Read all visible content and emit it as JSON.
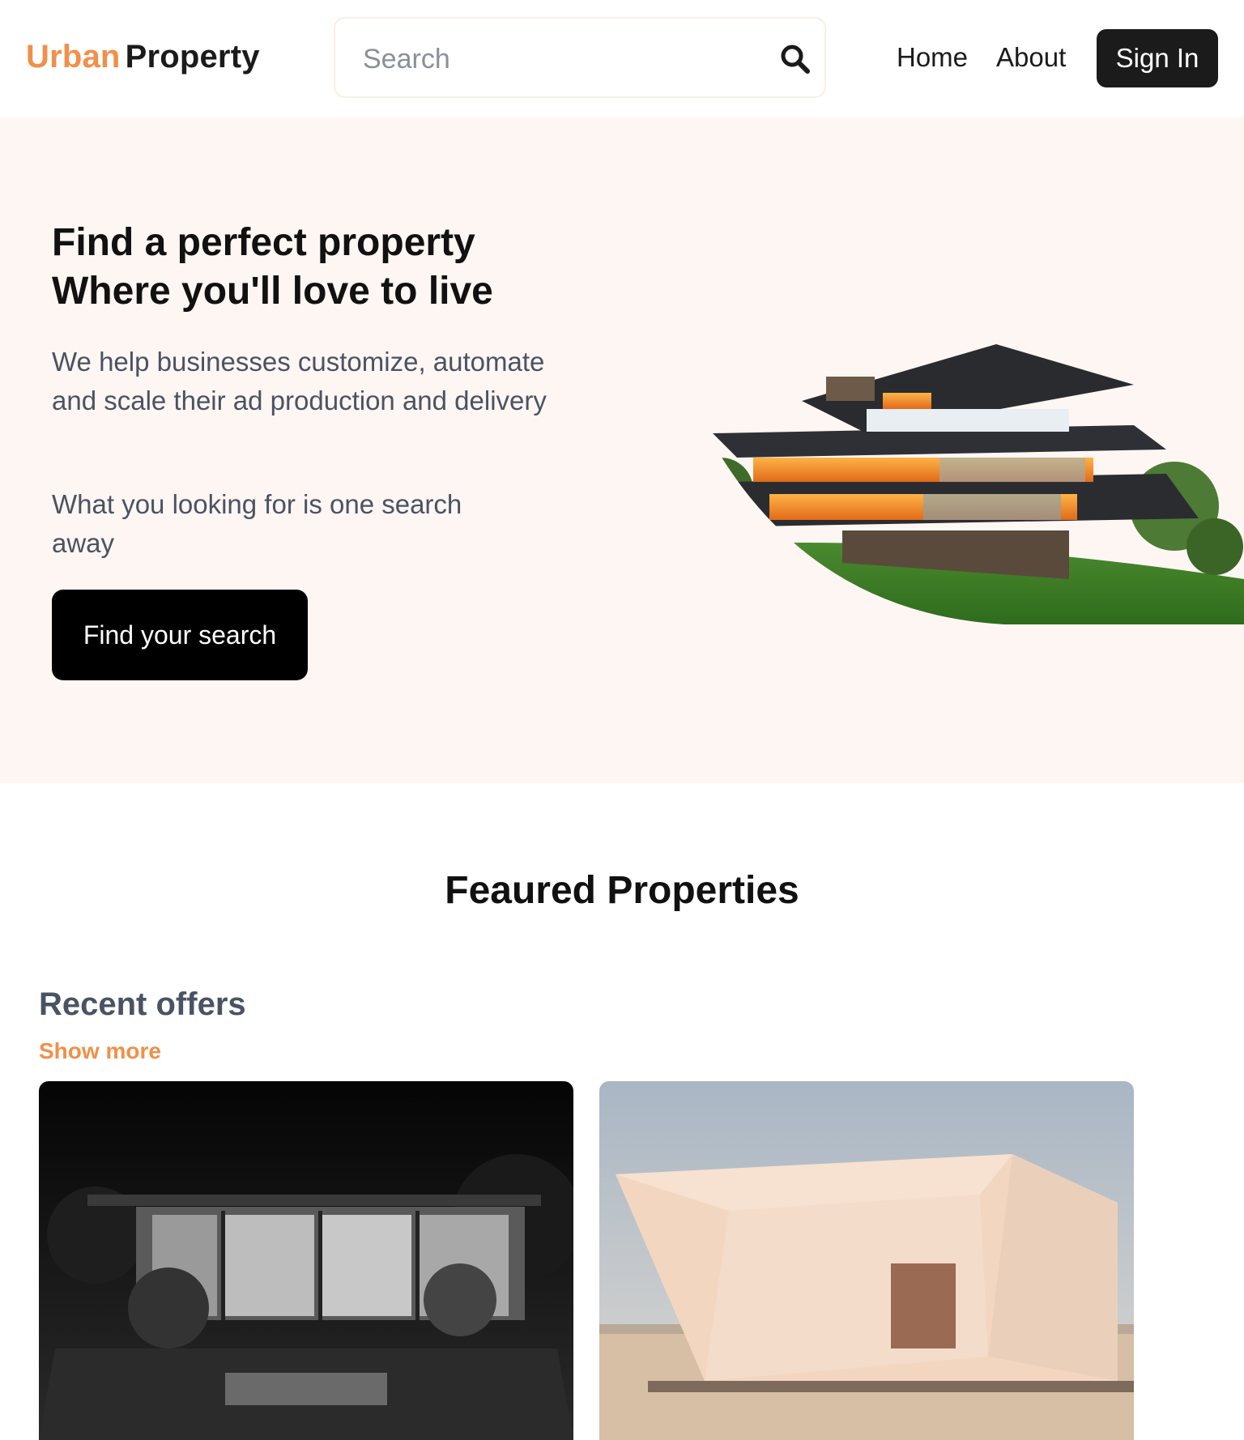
{
  "header": {
    "logo_part1": "Urban",
    "logo_part2": "Property",
    "search_placeholder": "Search",
    "search_icon": "search-icon",
    "nav": {
      "home": "Home",
      "about": "About",
      "signin": "Sign In"
    }
  },
  "hero": {
    "title_line1": "Find a perfect property",
    "title_line2": "Where you'll love to live",
    "description": "We help businesses customize, automate and scale their ad production and delivery",
    "tagline": "What you looking for is one search away",
    "cta": "Find your search"
  },
  "featured": {
    "title": "Feaured Properties",
    "recent_title": "Recent offers",
    "show_more": "Show more"
  },
  "colors": {
    "accent": "#f0904a",
    "dark": "#1b1b1b",
    "hero_bg": "#fdf6f2",
    "muted_text": "#4a5363"
  }
}
